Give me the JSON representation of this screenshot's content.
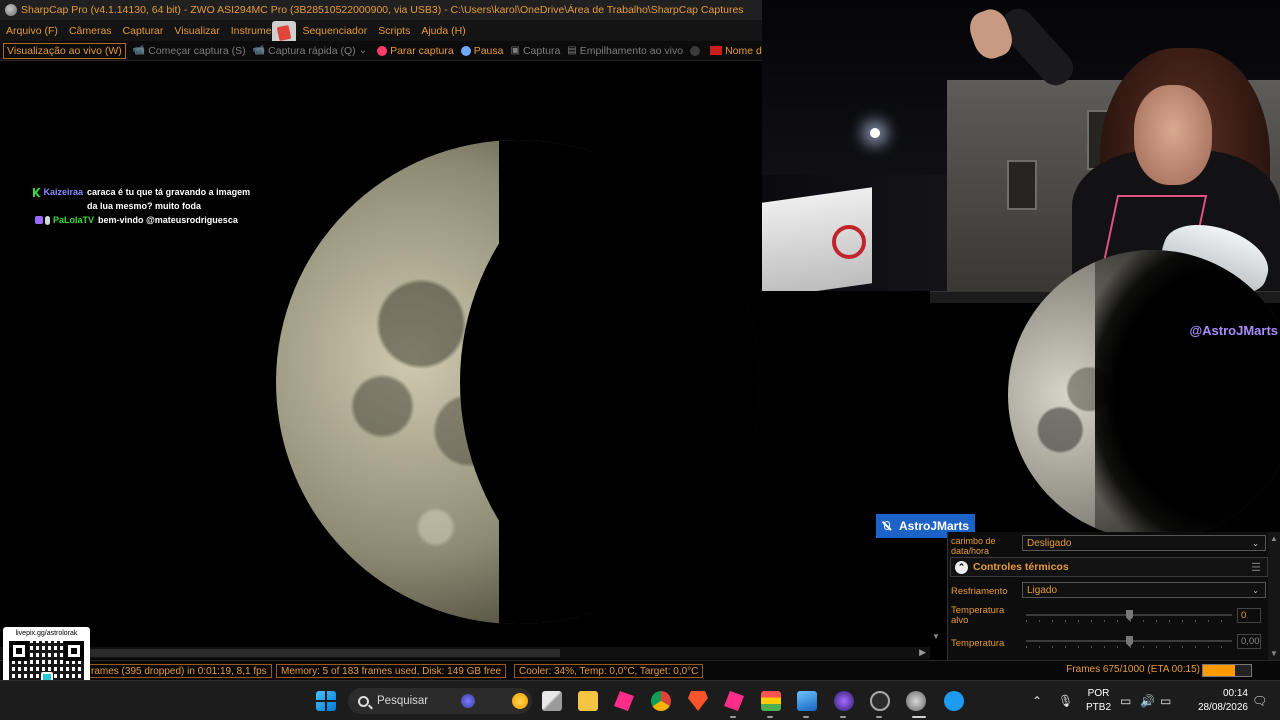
{
  "window": {
    "title": "SharpCap Pro (v4.1.14130, 64 bit) - ZWO ASI294MC Pro (3B28510522000900, via USB3) - C:\\Users\\karol\\OneDrive\\Área de Trabalho\\SharpCap Captures"
  },
  "menu": {
    "items": [
      "Arquivo (F)",
      "Câmeras",
      "Capturar",
      "Visualizar",
      "Instrumentos",
      "Sequenciador",
      "Scripts",
      "Ajuda (H)"
    ]
  },
  "toolbar": {
    "live_view": "Visualização ao vivo (W)",
    "start_capture": "Começar captura (S)",
    "quick_capture": "Captura rápida (Q)",
    "stop_capture": "Parar captura",
    "pause": "Pausa",
    "snapshot": "Captura",
    "live_stack": "Empilhamento ao vivo",
    "target_name": "Nome de destino"
  },
  "chat": {
    "messages": [
      {
        "user": "Kaizeiraa",
        "user_color": "#8a8aff",
        "text": "caraca é tu que tá gravando a imagem da lua mesmo? muito foda"
      },
      {
        "user": "PaLolaTV",
        "user_color": "#3ddc3d",
        "text": "bem-vindo @mateusrodriguesca"
      }
    ]
  },
  "overlay": {
    "handle": "@AstroJMarts",
    "nametag": "AstroJMarts"
  },
  "controls": {
    "timestamp_label": "carimbo de data/hora",
    "timestamp_value": "Desligado",
    "section_title": "Controles térmicos",
    "cooling_label": "Resfriamento",
    "cooling_value": "Ligado",
    "target_temp_label": "Temperatura alvo",
    "target_temp_value": "0",
    "target_temp_level": 0.5,
    "temp_label": "Temperatura",
    "temp_value": "0,00",
    "temp_level": 0.5
  },
  "status": {
    "frames_left": "rames (395 dropped) in 0:01:19, 8,1 fps",
    "memory": "Memory: 5 of 183 frames used, Disk: 149 GB free",
    "cooler": "Cooler: 34%, Temp: 0,0°C, Target: 0,0°C",
    "frames_progress": "Frames 675/1000 (ETA 00:15)",
    "progress_fraction": 0.675
  },
  "qr": {
    "url": "livepix.gg/astrolorak"
  },
  "taskbar": {
    "search_placeholder": "Pesquisar",
    "language": "POR",
    "keyboard": "PTB2",
    "time": "00:14",
    "date": "28/08/2026"
  },
  "colors": {
    "accent": "#e59a3c",
    "progress": "#ff9a00",
    "nametag": "#1d62c7",
    "handle": "#a88cff"
  }
}
